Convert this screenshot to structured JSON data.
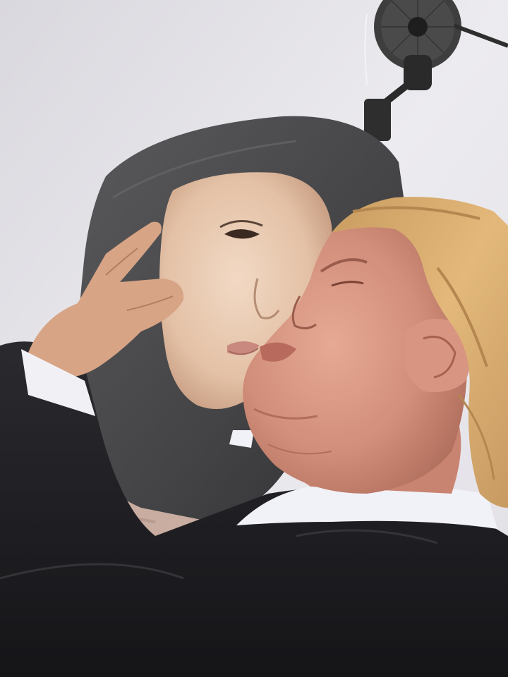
{
  "scene": {
    "subjects": [
      "person-in-grey-hijab",
      "man-in-dark-suit"
    ],
    "background": "white-wall-with-wall-fan"
  },
  "palette": {
    "wall": "#e6e4ea",
    "hijab": "#4a4a4c",
    "skin_woman": "#e8c8ae",
    "skin_man": "#d99c86",
    "hair_man": "#d8ac6c",
    "suit": "#1f1f23",
    "shirt": "#f3f4f8",
    "sweater": "#c8aca0",
    "fan": "#3a3a3a"
  }
}
